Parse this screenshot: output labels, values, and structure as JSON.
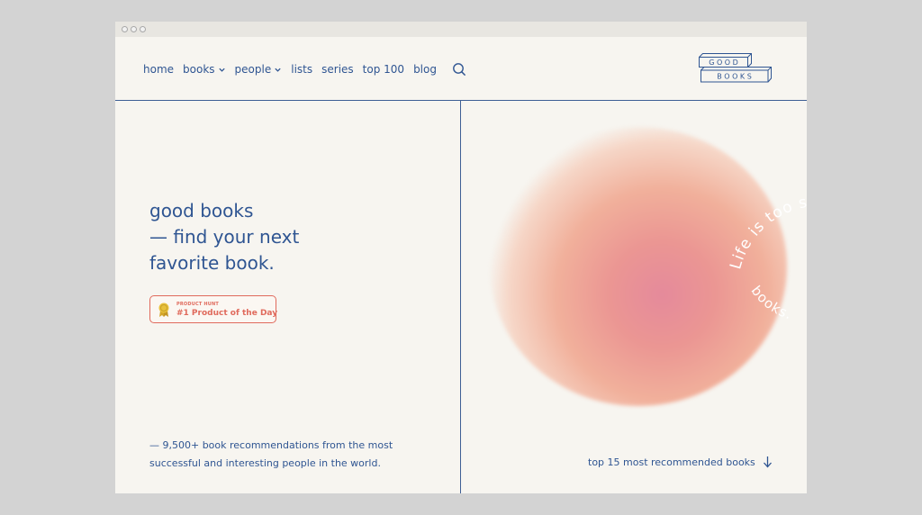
{
  "nav": {
    "items": [
      {
        "label": "home",
        "dropdown": false
      },
      {
        "label": "books",
        "dropdown": true
      },
      {
        "label": "people",
        "dropdown": true
      },
      {
        "label": "lists",
        "dropdown": false
      },
      {
        "label": "series",
        "dropdown": false
      },
      {
        "label": "top 100",
        "dropdown": false
      },
      {
        "label": "blog",
        "dropdown": false
      }
    ],
    "search_icon": "search-icon"
  },
  "logo": {
    "line1": "G O O D",
    "line2": "B O O K S"
  },
  "hero": {
    "line1": "good books",
    "line2": "— find your next",
    "line3": "favorite book."
  },
  "badge": {
    "small_text": "PRODUCT HUNT",
    "main_text": "#1 Product of the Day",
    "icon": "medal-icon"
  },
  "summary": {
    "line1": "— 9,500+ book recommendations from the most",
    "line2": "successful and interesting people in the world."
  },
  "top_link": {
    "label": "top 15 most recommended books",
    "icon": "arrow-down-icon"
  },
  "arc_text": {
    "upper": "Life is too s",
    "lower": "books."
  },
  "colors": {
    "ink": "#2f5592",
    "accent": "#e06a5c",
    "background": "#f7f5f0",
    "frame": "#d3d3d3"
  }
}
